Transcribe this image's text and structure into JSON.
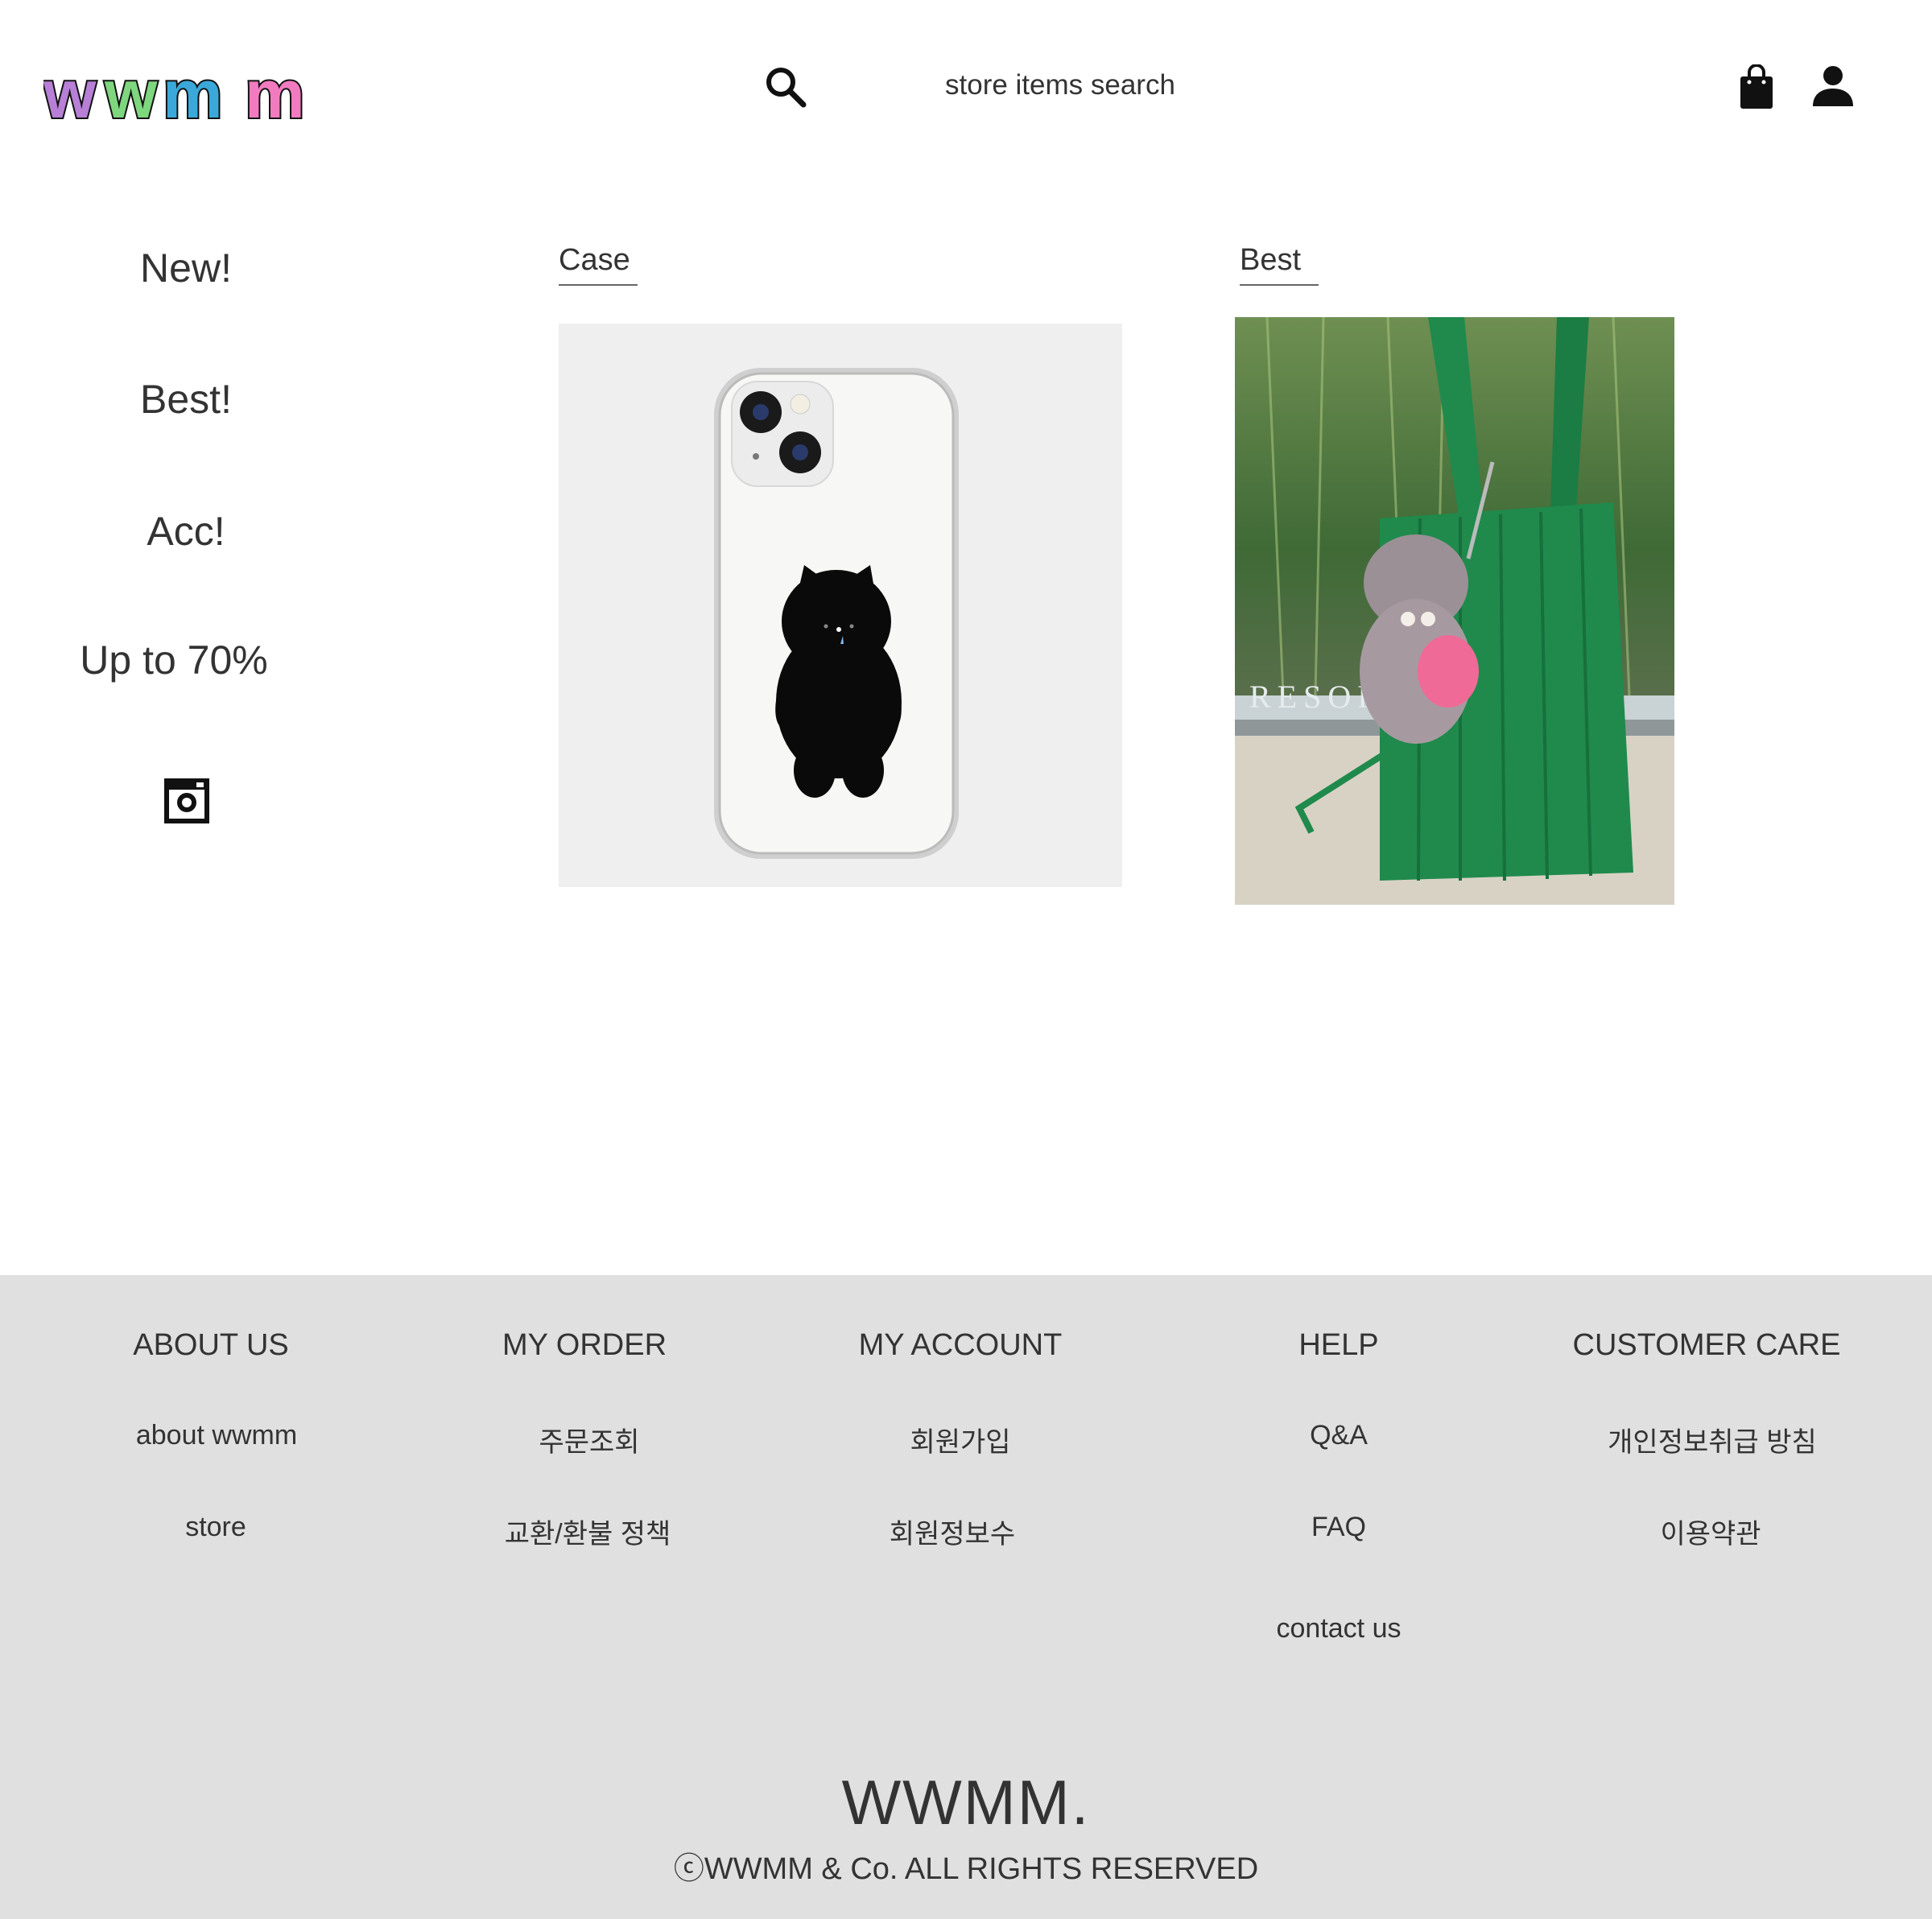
{
  "header": {
    "logo_text": "wwmm",
    "search_placeholder": "store items search",
    "icons": [
      "search-icon",
      "shopping-bag-icon",
      "user-icon"
    ]
  },
  "sidebar": {
    "items": [
      {
        "label": "New!"
      },
      {
        "label": "Best!"
      },
      {
        "label": "Acc!"
      },
      {
        "label": "Up to 70%"
      }
    ],
    "social_icon": "instagram-icon"
  },
  "main": {
    "sections": [
      {
        "title": "Case"
      },
      {
        "title": "Best"
      }
    ]
  },
  "footer": {
    "columns": [
      {
        "heading": "ABOUT US",
        "links": [
          "about wwmm",
          "store"
        ]
      },
      {
        "heading": "MY ORDER",
        "links": [
          "주문조회",
          "교환/환불 정책"
        ]
      },
      {
        "heading": "MY ACCOUNT",
        "links": [
          "회원가입",
          "회원정보수"
        ]
      },
      {
        "heading": "HELP",
        "links": [
          "Q&A",
          "FAQ",
          "contact us"
        ]
      },
      {
        "heading": "CUSTOMER CARE",
        "links": [
          "개인정보취급 방침",
          "이용약관"
        ]
      }
    ],
    "brand": "WWMM.",
    "copyright": "ⓒWWMM & Co. ALL RIGHTS RESERVED"
  },
  "colors": {
    "footer_bg": "#e0e0e0",
    "text": "#333333",
    "logo_purple": "#b77fd6",
    "logo_green": "#7ed67e",
    "logo_blue": "#3aa9d9",
    "logo_pink": "#f27bc0",
    "bag_green": "#1f8a4c"
  }
}
